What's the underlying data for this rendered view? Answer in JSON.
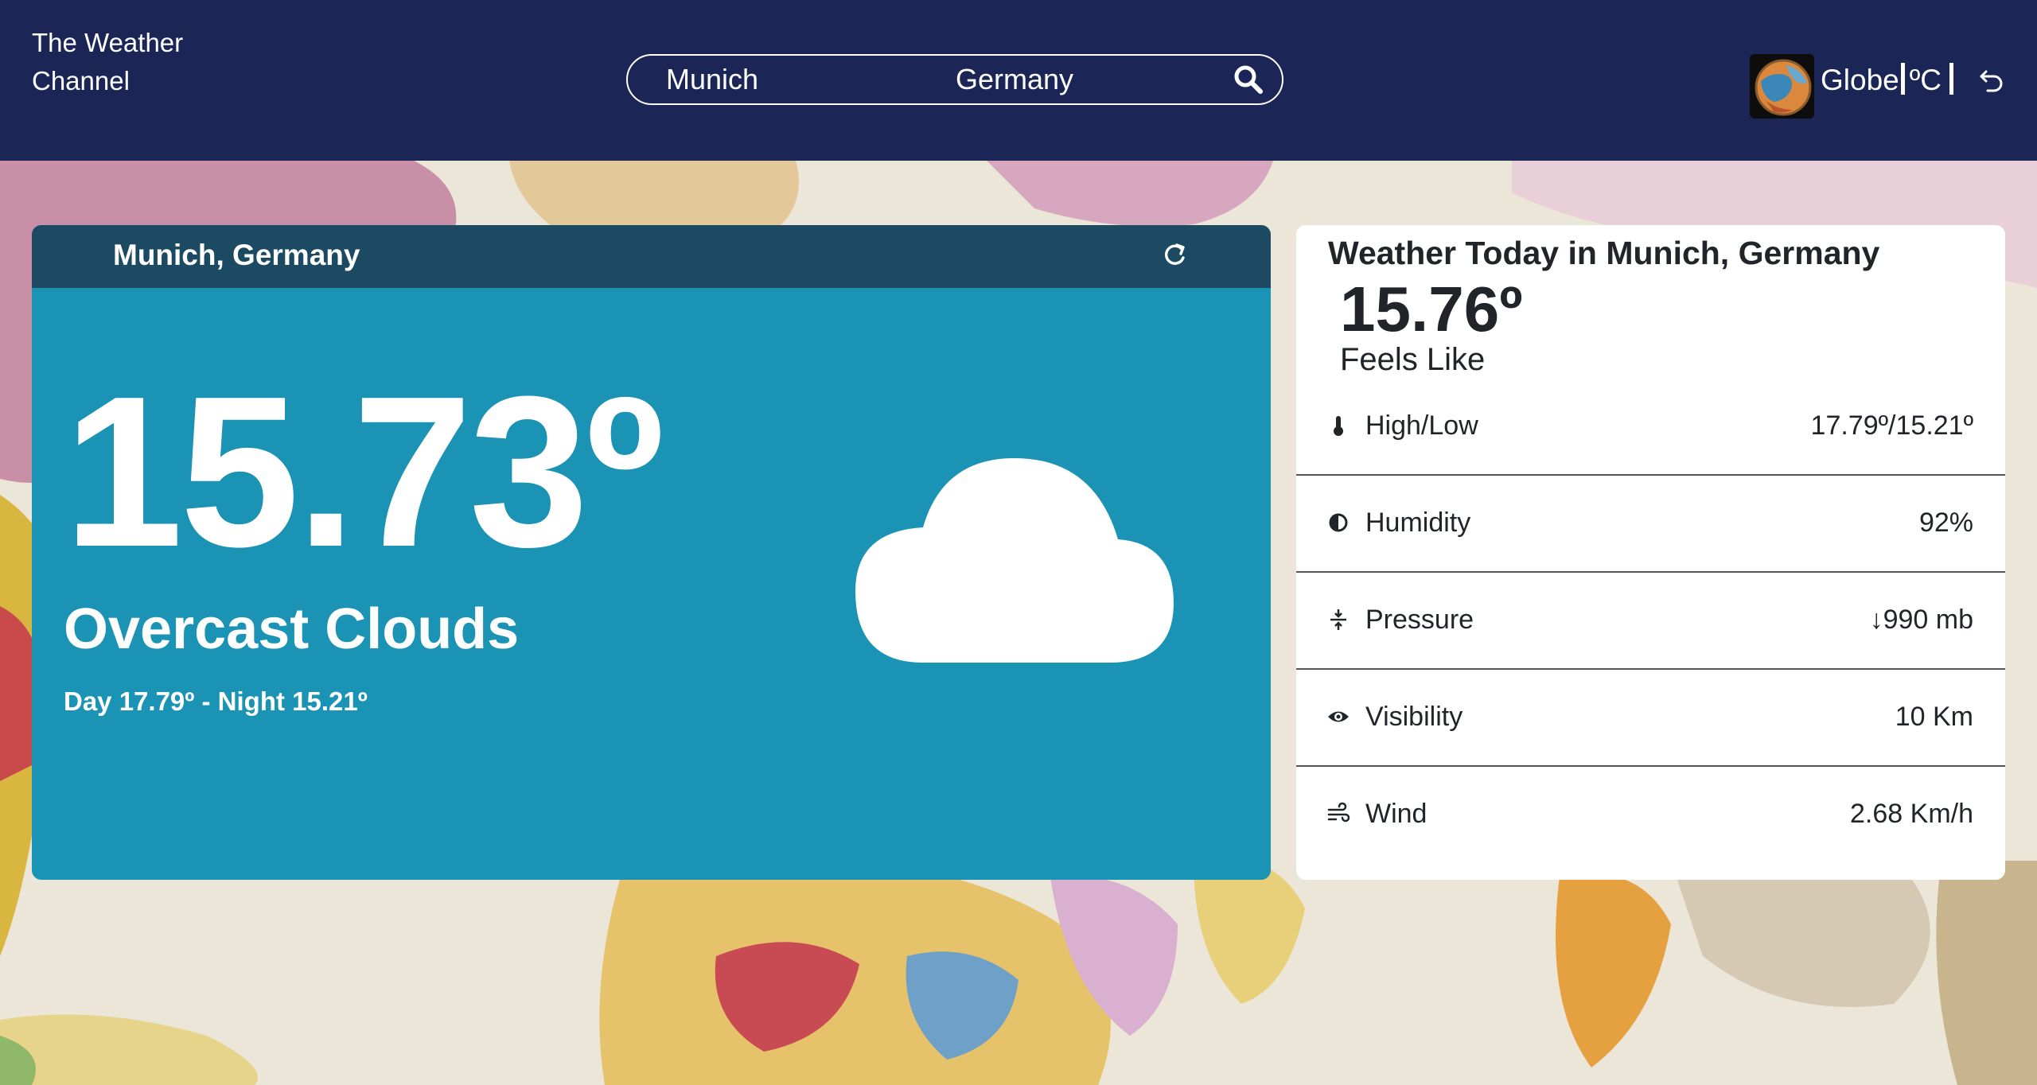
{
  "header": {
    "brand": "The Weather Channel",
    "search": {
      "city_value": "Munich",
      "country_value": "Germany"
    },
    "globe_label": "Globe",
    "unit_label": "ºC"
  },
  "main": {
    "location": "Munich, Germany",
    "temperature": "15.73º",
    "condition": "Overcast Clouds",
    "day_night": "Day 17.79º - Night 15.21º"
  },
  "details": {
    "title": "Weather Today in Munich, Germany",
    "feels_like_temp": "15.76º",
    "feels_like_label": "Feels Like",
    "rows": [
      {
        "label": "High/Low",
        "value": "17.79º/15.21º",
        "icon": "thermometer-icon"
      },
      {
        "label": "Humidity",
        "value": "92%",
        "icon": "humidity-icon"
      },
      {
        "label": "Pressure",
        "value": "↓990 mb",
        "icon": "pressure-icon"
      },
      {
        "label": "Visibility",
        "value": "10 Km",
        "icon": "eye-icon"
      },
      {
        "label": "Wind",
        "value": "2.68 Km/h",
        "icon": "wind-icon"
      }
    ]
  },
  "colors": {
    "header_bg": "#1b2656",
    "main_card": "#1b93b5",
    "main_card_bar": "#1c4a63"
  }
}
